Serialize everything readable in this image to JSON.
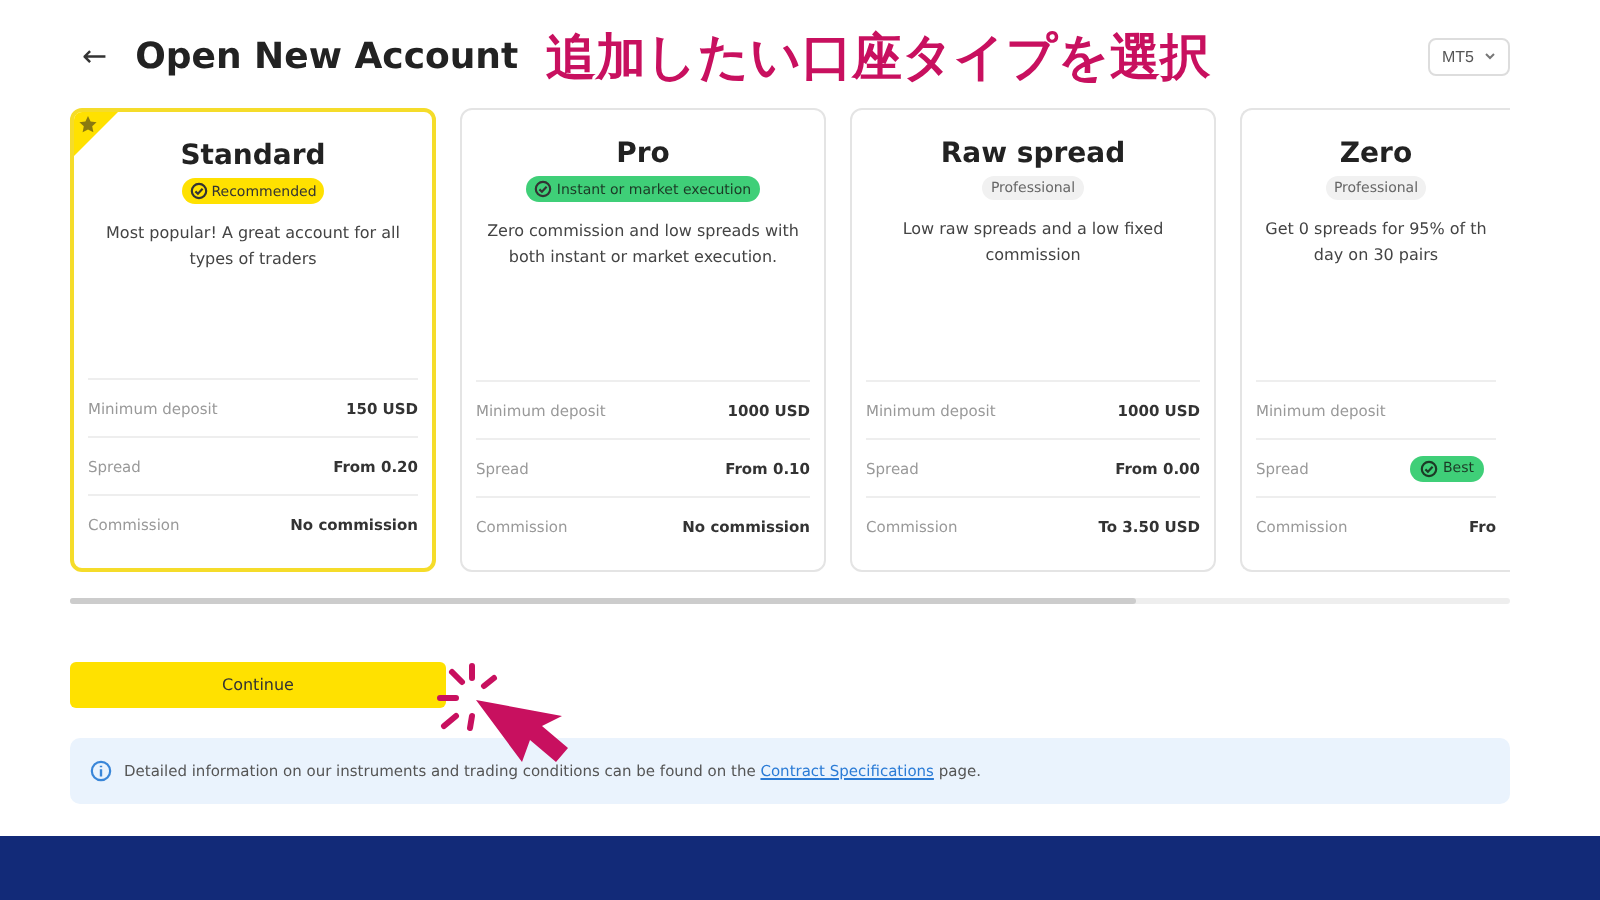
{
  "header": {
    "back": "←",
    "title": "Open New Account",
    "annotation": "追加したい口座タイプを選択",
    "platform": "MT5"
  },
  "cards": [
    {
      "name": "Standard",
      "selected": true,
      "badge": {
        "text": "Recommended",
        "kind": "yellow"
      },
      "description": "Most popular! A great account for all types of traders",
      "rows": [
        {
          "label": "Minimum deposit",
          "value": "150 USD",
          "kind": "text"
        },
        {
          "label": "Spread",
          "value": "From 0.20",
          "kind": "text"
        },
        {
          "label": "Commission",
          "value": "No commission",
          "kind": "text"
        }
      ]
    },
    {
      "name": "Pro",
      "selected": false,
      "badge": {
        "text": "Instant or market execution",
        "kind": "green"
      },
      "description": "Zero commission and low spreads with both instant or market execution.",
      "rows": [
        {
          "label": "Minimum deposit",
          "value": "1000 USD",
          "kind": "text"
        },
        {
          "label": "Spread",
          "value": "From 0.10",
          "kind": "text"
        },
        {
          "label": "Commission",
          "value": "No commission",
          "kind": "text"
        }
      ]
    },
    {
      "name": "Raw spread",
      "selected": false,
      "badge": {
        "text": "Professional",
        "kind": "gray"
      },
      "description": "Low raw spreads and a low fixed commission",
      "rows": [
        {
          "label": "Minimum deposit",
          "value": "1000 USD",
          "kind": "text"
        },
        {
          "label": "Spread",
          "value": "From 0.00",
          "kind": "text"
        },
        {
          "label": "Commission",
          "value": "To 3.50 USD",
          "kind": "text"
        }
      ]
    },
    {
      "name": "Zero",
      "selected": false,
      "badge": {
        "text": "Professional",
        "kind": "gray"
      },
      "description": "Get 0 spreads for 95% of th day on 30 pairs",
      "rows": [
        {
          "label": "Minimum deposit"
        },
        {
          "label": "Spread",
          "value": "Best",
          "kind": "badge"
        },
        {
          "label": "Commission",
          "value": "Fro",
          "kind": "text"
        }
      ]
    }
  ],
  "continue": "Continue",
  "info": {
    "text": "Detailed information on our instruments and trading conditions can be found on the",
    "link": "Contract Specifications",
    "after": "page."
  }
}
